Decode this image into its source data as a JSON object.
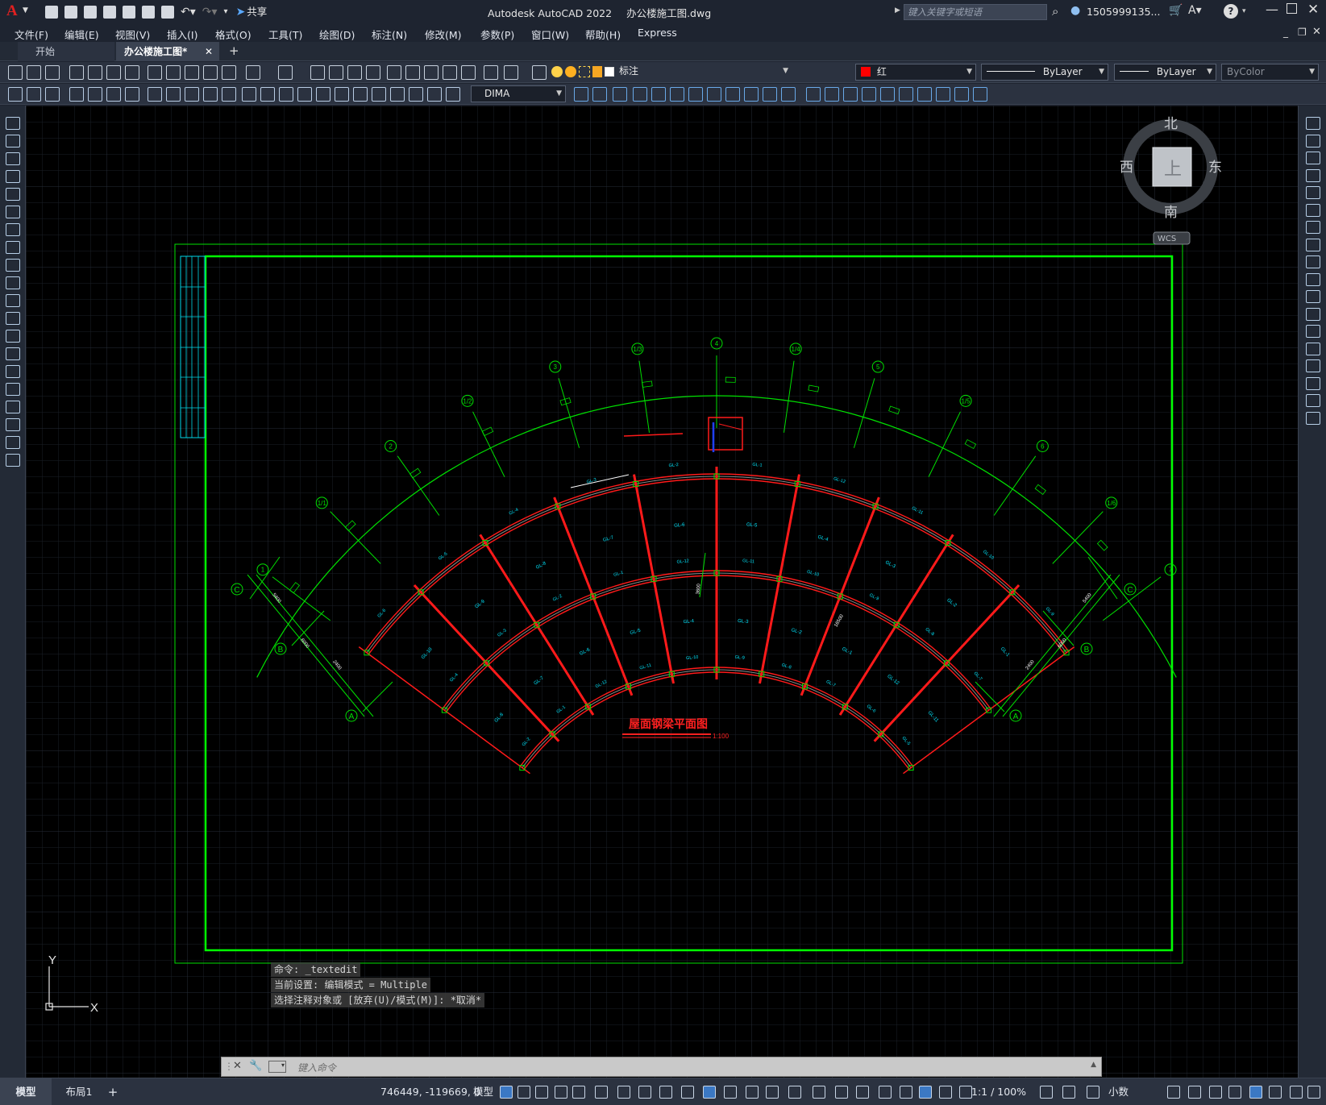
{
  "app": {
    "logo": "A",
    "title": "Autodesk AutoCAD 2022",
    "filename": "办公楼施工图.dwg",
    "share_label": "共享",
    "search_placeholder": "键入关键字或短语",
    "user": "1505999135...",
    "help": "?"
  },
  "menu": [
    "文件(F)",
    "编辑(E)",
    "视图(V)",
    "插入(I)",
    "格式(O)",
    "工具(T)",
    "绘图(D)",
    "标注(N)",
    "修改(M)",
    "参数(P)",
    "窗口(W)",
    "帮助(H)",
    "Express"
  ],
  "tabs": {
    "start": "开始",
    "doc": "办公楼施工图*",
    "add": "+"
  },
  "toolbar": {
    "layer_name": "标注",
    "color_name": "红",
    "linetype": "ByLayer",
    "lineweight": "ByLayer",
    "plotstyle": "ByColor",
    "dimstyle": "DIMA"
  },
  "viewcube": {
    "north": "北",
    "south": "南",
    "east": "东",
    "west": "西",
    "top": "上",
    "wcs": "WCS"
  },
  "ucs": {
    "x": "X",
    "y": "Y"
  },
  "drawing": {
    "title": "屋面钢梁平面图",
    "scale": "1:100",
    "grid_numbers": [
      "1",
      "1/1",
      "2",
      "1/2",
      "3",
      "1/3",
      "4",
      "1/4",
      "5",
      "1/5",
      "6",
      "1/6",
      "7"
    ],
    "grid_letters": [
      "A",
      "B",
      "C"
    ],
    "beam_labels": [
      "GL-1",
      "GL-2",
      "GL-3",
      "GL-4",
      "GL-5",
      "GL-6",
      "GL-7",
      "GL-8",
      "GL-9",
      "GL-10",
      "GL-11",
      "GL-12"
    ],
    "dims": [
      "5400",
      "6000",
      "2400",
      "3600",
      "16500"
    ]
  },
  "command": {
    "lines": [
      "命令: _textedit",
      "当前设置: 编辑模式 = Multiple",
      "选择注释对象或 [放弃(U)/模式(M)]: *取消*"
    ],
    "placeholder": "键入命令"
  },
  "status": {
    "model_tab": "模型",
    "layout_tab": "布局1",
    "add": "+",
    "coords": "746449, -119669, 0",
    "model": "模型",
    "scale": "1:1 / 100%",
    "units": "小数"
  }
}
